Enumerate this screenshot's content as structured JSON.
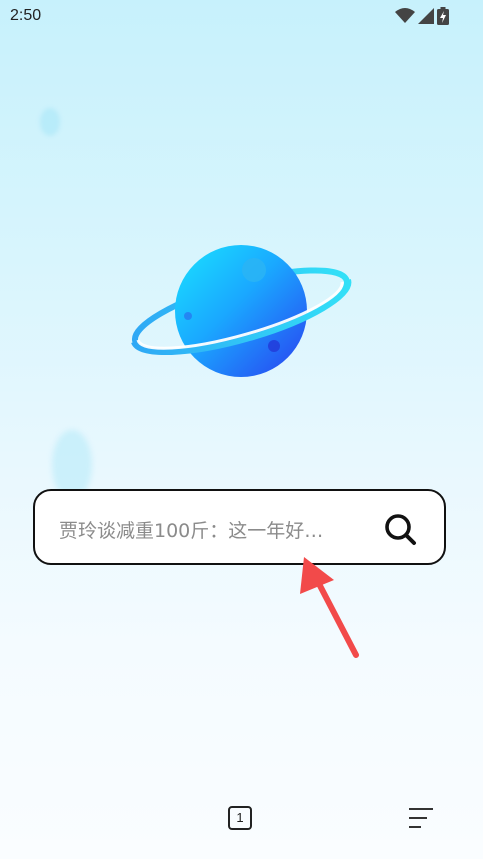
{
  "status_bar": {
    "time": "2:50",
    "icons": [
      "wifi-icon",
      "signal-icon",
      "battery-charging-icon"
    ]
  },
  "logo": {
    "icon": "planet-logo-icon"
  },
  "search": {
    "placeholder": "贾玲谈减重100斤：这一年好…",
    "icon": "search-icon"
  },
  "annotation": {
    "icon": "red-arrow-icon",
    "color": "#f24a4a"
  },
  "bottom_bar": {
    "tab_count": "1",
    "menu_icon": "menu-lines-icon"
  },
  "colors": {
    "background_top": "#c7f1fc",
    "planet_light": "#1ad0ff",
    "planet_dark": "#2a4af0",
    "ring": "#2fd5f7"
  }
}
